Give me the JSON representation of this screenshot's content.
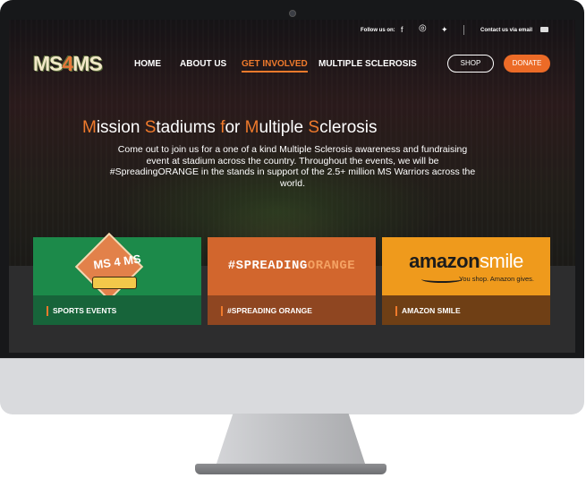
{
  "header": {
    "follow_label": "Follow us on:",
    "social_icons": [
      "facebook-icon",
      "instagram-icon",
      "twitter-icon"
    ],
    "contact_label": "Contact us via email"
  },
  "nav": {
    "logo": {
      "prefix": "MS",
      "four": "4",
      "suffix": "MS"
    },
    "items": [
      {
        "label": "HOME"
      },
      {
        "label": "ABOUT US"
      },
      {
        "label": "GET INVOLVED",
        "active": true
      },
      {
        "label": "MULTIPLE SCLEROSIS"
      }
    ],
    "shop_label": "SHOP",
    "donate_label": "DONATE"
  },
  "hero": {
    "title_parts": [
      "M",
      "ission ",
      "S",
      "tadiums ",
      "f",
      "or ",
      "M",
      "ultiple ",
      "S",
      "clerosis"
    ],
    "description": "Come out to join us for a one of a kind Multiple Sclerosis awareness and fundraising event at stadium across the country. Throughout the events, we will be #SpreadingORANGE in the stands in support of the 2.5+ million MS Warriors across the world."
  },
  "cards": [
    {
      "label": "SPORTS EVENTS",
      "image_text": "MS 4 MS"
    },
    {
      "label": "#SPREADING ORANGE",
      "image_text_white": "#SPREADING",
      "image_text_orange": "ORANGE"
    },
    {
      "label": "AMAZON SMILE",
      "image_text_dark": "amazon",
      "image_text_light": "smile",
      "tagline": "You shop. Amazon gives."
    }
  ],
  "colors": {
    "accent": "#ef7a2c",
    "sports": "#1c8a4a",
    "spreading": "#d2662d",
    "amazon": "#ef9a1c"
  }
}
